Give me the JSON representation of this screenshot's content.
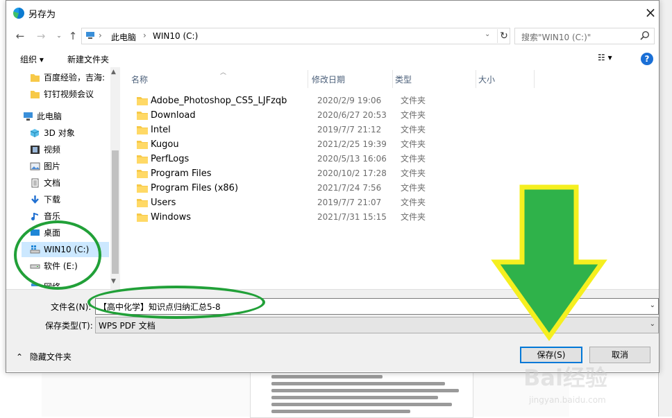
{
  "dialog": {
    "title": "另存为"
  },
  "address": {
    "segments": [
      "此电脑",
      "WIN10 (C:)"
    ],
    "separator": "›"
  },
  "search": {
    "placeholder": "搜索\"WIN10 (C:)\""
  },
  "toolbar": {
    "organize": "组织 ▾",
    "new_folder": "新建文件夹",
    "view": "☷ ▾",
    "help": "?"
  },
  "nav": [
    {
      "label": "百度经验，吉海:",
      "icon": "folder-icon"
    },
    {
      "label": "钉钉视频会议",
      "icon": "folder-icon"
    },
    {
      "label": "此电脑",
      "icon": "pc-icon"
    },
    {
      "label": "3D 对象",
      "icon": "cube-icon"
    },
    {
      "label": "视频",
      "icon": "video-icon"
    },
    {
      "label": "图片",
      "icon": "picture-icon"
    },
    {
      "label": "文档",
      "icon": "document-icon"
    },
    {
      "label": "下载",
      "icon": "download-icon"
    },
    {
      "label": "音乐",
      "icon": "music-icon"
    },
    {
      "label": "桌面",
      "icon": "desktop-icon"
    },
    {
      "label": "WIN10 (C:)",
      "icon": "drive-c-icon",
      "selected": true
    },
    {
      "label": "软件 (E:)",
      "icon": "drive-e-icon"
    },
    {
      "label": "网络",
      "icon": "network-icon"
    }
  ],
  "columns": {
    "name": "名称",
    "date": "修改日期",
    "type": "类型",
    "size": "大小"
  },
  "files": [
    {
      "name": "Adobe_Photoshop_CS5_LJFzqb",
      "date": "2020/2/9 19:06",
      "type": "文件夹"
    },
    {
      "name": "Download",
      "date": "2020/6/27 20:53",
      "type": "文件夹"
    },
    {
      "name": "Intel",
      "date": "2019/7/7 21:12",
      "type": "文件夹"
    },
    {
      "name": "Kugou",
      "date": "2021/2/25 19:39",
      "type": "文件夹"
    },
    {
      "name": "PerfLogs",
      "date": "2020/5/13 16:06",
      "type": "文件夹"
    },
    {
      "name": "Program Files",
      "date": "2020/10/2 17:28",
      "type": "文件夹"
    },
    {
      "name": "Program Files (x86)",
      "date": "2021/7/24 7:56",
      "type": "文件夹"
    },
    {
      "name": "Users",
      "date": "2019/7/7 21:07",
      "type": "文件夹"
    },
    {
      "name": "Windows",
      "date": "2021/7/31 15:15",
      "type": "文件夹"
    }
  ],
  "form": {
    "filename_label": "文件名(N):",
    "filename_value": "【高中化学】知识点归纳汇总5-8",
    "filetype_label": "保存类型(T):",
    "filetype_value": "WPS PDF 文档",
    "hide_folders": "隐藏文件夹",
    "save": "保存(S)",
    "cancel": "取消"
  },
  "watermark": {
    "text": "Bai经验",
    "url": "jingyan.baidu.com"
  },
  "colors": {
    "accent": "#0078d7",
    "annotation_green": "#21a038",
    "arrow_fill": "#2fb24a",
    "arrow_outline": "#f5ef1f",
    "selection": "#cce8ff"
  }
}
